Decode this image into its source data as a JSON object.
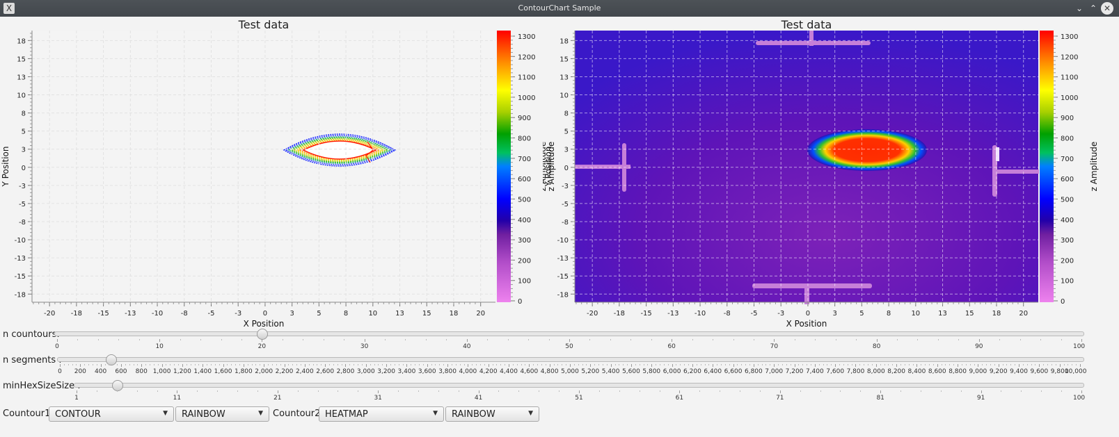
{
  "window": {
    "title": "ContourChart Sample",
    "app_icon": "X"
  },
  "charts": [
    {
      "title": "Test data",
      "xlabel": "X Position",
      "ylabel": "Y Position",
      "zlabel": "z Amplitude",
      "xticks": [
        "-20",
        "-18",
        "-15",
        "-13",
        "-10",
        "-8",
        "-5",
        "-3",
        "0",
        "3",
        "5",
        "8",
        "10",
        "13",
        "15",
        "18",
        "20"
      ],
      "yticks": [
        "18",
        "15",
        "13",
        "10",
        "8",
        "5",
        "3",
        "0",
        "-3",
        "-5",
        "-8",
        "-10",
        "-13",
        "-15",
        "-18"
      ],
      "zticks": [
        "1300",
        "1200",
        "1100",
        "1000",
        "900",
        "800",
        "700",
        "600",
        "500",
        "400",
        "300",
        "200",
        "100",
        "0"
      ],
      "mode": "CONTOUR",
      "colormap": "RAINBOW"
    },
    {
      "title": "Test data",
      "xlabel": "X Position",
      "ylabel": "Y Position",
      "zlabel": "z Amplitude",
      "ylabel_overlay": "z Amplitude",
      "xticks": [
        "-20",
        "-18",
        "-15",
        "-13",
        "-10",
        "-8",
        "-5",
        "-3",
        "0",
        "3",
        "5",
        "8",
        "10",
        "13",
        "15",
        "18",
        "20"
      ],
      "yticks": [
        "18",
        "15",
        "13",
        "10",
        "8",
        "5",
        "3",
        "0",
        "-3",
        "-5",
        "-8",
        "-10",
        "-13",
        "-15",
        "-18"
      ],
      "zticks": [
        "1300",
        "1200",
        "1100",
        "1000",
        "900",
        "800",
        "700",
        "600",
        "500",
        "400",
        "300",
        "200",
        "100",
        "0"
      ],
      "mode": "HEATMAP",
      "colormap": "RAINBOW"
    }
  ],
  "controls": {
    "n_contours": {
      "label": "n countours:",
      "value": 20,
      "min": 0,
      "max": 100,
      "ticks": [
        "0",
        "10",
        "20",
        "30",
        "40",
        "50",
        "60",
        "70",
        "80",
        "90",
        "100"
      ]
    },
    "n_segments": {
      "label": "n segments :",
      "value": 500,
      "min": 0,
      "max": 10000,
      "ticks": [
        "0",
        "200",
        "400",
        "600",
        "800",
        "1,000",
        "1,200",
        "1,400",
        "1,600",
        "1,800",
        "2,000",
        "2,200",
        "2,400",
        "2,600",
        "2,800",
        "3,000",
        "3,200",
        "3,400",
        "3,600",
        "3,800",
        "4,000",
        "4,200",
        "4,400",
        "4,600",
        "4,800",
        "5,000",
        "5,200",
        "5,400",
        "5,600",
        "5,800",
        "6,000",
        "6,200",
        "6,400",
        "6,600",
        "6,800",
        "7,000",
        "7,200",
        "7,400",
        "7,600",
        "7,800",
        "8,000",
        "8,200",
        "8,400",
        "8,600",
        "8,800",
        "9,000",
        "9,200",
        "9,400",
        "9,600",
        "9,800",
        "10,000"
      ]
    },
    "min_hex_size": {
      "label": "minHexSizeSize :",
      "value": 5,
      "min": 1,
      "max": 100,
      "ticks": [
        "1",
        "11",
        "21",
        "31",
        "41",
        "51",
        "61",
        "71",
        "81",
        "91",
        "100"
      ]
    }
  },
  "footer": {
    "contour1_label": "Countour1:",
    "contour1_mode": "CONTOUR",
    "contour1_colormap": "RAINBOW",
    "contour2_label": "Countour2:",
    "contour2_mode": "HEATMAP",
    "contour2_colormap": "RAINBOW"
  },
  "icons": {
    "minimize": "chevron-down-icon",
    "maximize": "chevron-up-icon",
    "close": "close-icon",
    "combo": "chevron-down-icon"
  }
}
